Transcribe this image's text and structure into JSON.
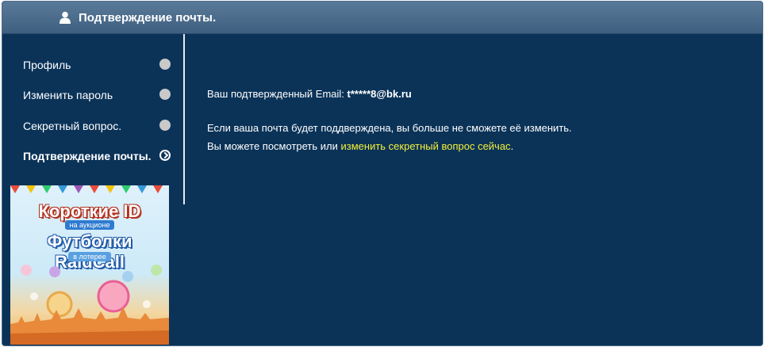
{
  "header": {
    "title": "Подтверждение почты.",
    "icon": "user-icon"
  },
  "sidebar": {
    "items": [
      {
        "label": "Профиль",
        "active": false
      },
      {
        "label": "Изменить пароль",
        "active": false
      },
      {
        "label": "Секретный вопрос.",
        "active": false
      },
      {
        "label": "Подтверждение почты.",
        "active": true
      }
    ]
  },
  "banner": {
    "line1": "Короткие ID",
    "line2": "на аукционе",
    "line3": "Футболки RaidCall",
    "line4": "в лотерее"
  },
  "main": {
    "email_label": "Ваш подтвержденный Email:",
    "email_value": "t*****8@bk.ru",
    "note_line1": "Если ваша почта будет поддверждена, вы больше не сможете её изменить.",
    "note_line2_prefix": "Вы можете посмотреть или",
    "note_line2_link": "изменить секретный вопрос сейчас",
    "note_line2_suffix": "."
  },
  "colors": {
    "background": "#0b3358",
    "header": "#4a6a8a",
    "link": "#f3ef3a"
  }
}
